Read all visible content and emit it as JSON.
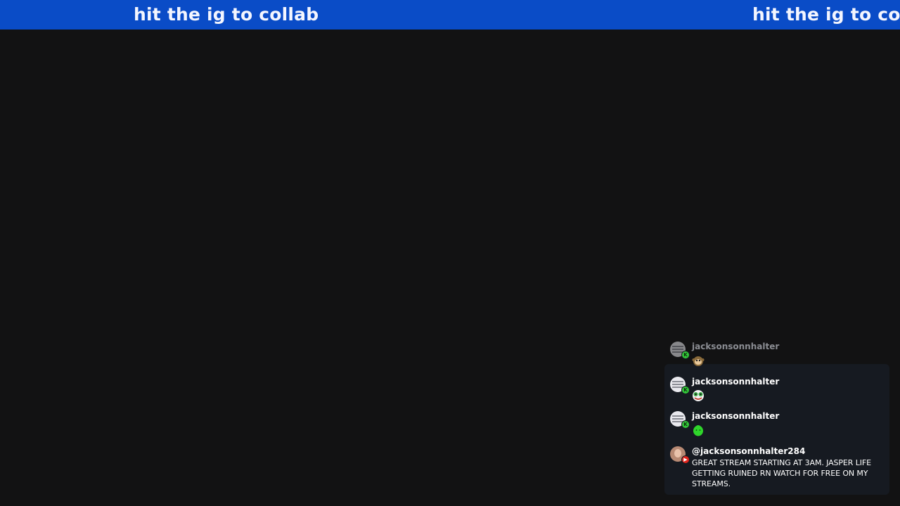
{
  "banner": {
    "text_primary": "hit the ig to collab",
    "text_secondary": "hit the ig to colla",
    "color": "#0a4cc7"
  },
  "chat": {
    "messages": [
      {
        "username": "jacksonsonnhalter",
        "platform": "kick",
        "platform_icon": "kick-icon",
        "emote": "monkey-emote-icon",
        "faded": true
      },
      {
        "username": "jacksonsonnhalter",
        "platform": "kick",
        "platform_icon": "kick-icon",
        "emote": "frog-face-emote-icon",
        "faded": false
      },
      {
        "username": "jacksonsonnhalter",
        "platform": "kick",
        "platform_icon": "kick-icon",
        "emote": "green-blob-emote-icon",
        "faded": false
      },
      {
        "username": "@jacksonsonnhalter284",
        "platform": "youtube",
        "platform_icon": "youtube-icon",
        "text": "GREAT STREAM STARTING AT 3AM. JASPER LIFE GETTING RUINED RN WATCH FOR FREE ON MY STREAMS.",
        "faded": false
      }
    ],
    "colors": {
      "kick": "#33c63a",
      "youtube": "#e0231b",
      "panel": "#171b22"
    }
  }
}
